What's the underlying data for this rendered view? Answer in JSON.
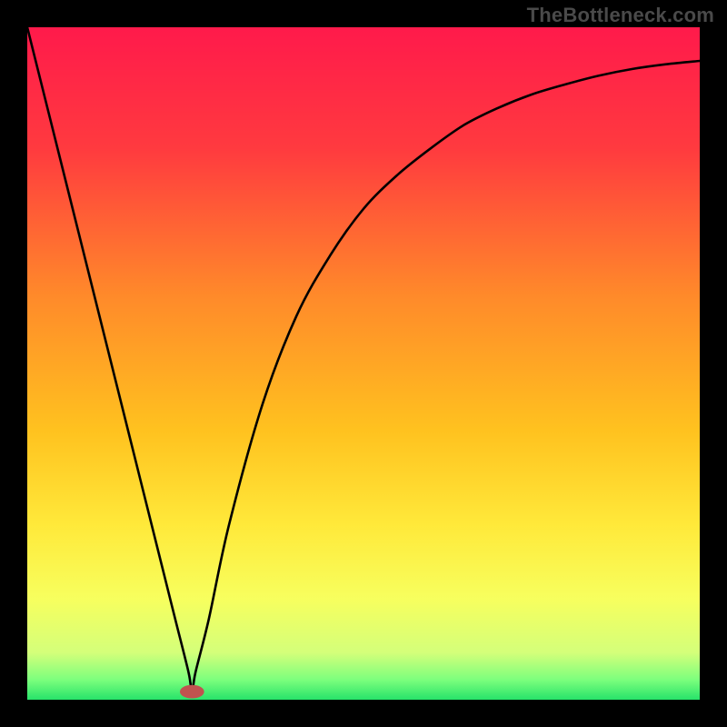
{
  "watermark": "TheBottleneck.com",
  "chart_data": {
    "type": "line",
    "title": "",
    "xlabel": "",
    "ylabel": "",
    "xlim": [
      0,
      100
    ],
    "ylim": [
      0,
      100
    ],
    "grid": false,
    "legend": null,
    "gradient_stops": [
      {
        "offset": 0,
        "color": "#ff1a4b"
      },
      {
        "offset": 18,
        "color": "#ff3a3f"
      },
      {
        "offset": 40,
        "color": "#ff8a2a"
      },
      {
        "offset": 60,
        "color": "#ffc21f"
      },
      {
        "offset": 74,
        "color": "#ffe93a"
      },
      {
        "offset": 85,
        "color": "#f7ff5e"
      },
      {
        "offset": 93,
        "color": "#d4ff7a"
      },
      {
        "offset": 97,
        "color": "#7dff7d"
      },
      {
        "offset": 100,
        "color": "#27e36a"
      }
    ],
    "marker": {
      "x": 24.5,
      "y": 1.2,
      "color": "#c0524f",
      "rx": 1.8,
      "ry": 1.0
    },
    "series": [
      {
        "name": "curve",
        "x": [
          0,
          5,
          10,
          15,
          20,
          22,
          24,
          24.5,
          25,
          27,
          30,
          35,
          40,
          45,
          50,
          55,
          60,
          65,
          70,
          75,
          80,
          85,
          90,
          95,
          100
        ],
        "values": [
          100,
          80,
          60,
          40,
          20,
          12,
          4,
          1,
          4,
          12,
          26,
          44,
          57,
          66,
          73,
          78,
          82,
          85.5,
          88,
          90,
          91.5,
          92.8,
          93.8,
          94.5,
          95
        ]
      }
    ],
    "annotations": []
  }
}
